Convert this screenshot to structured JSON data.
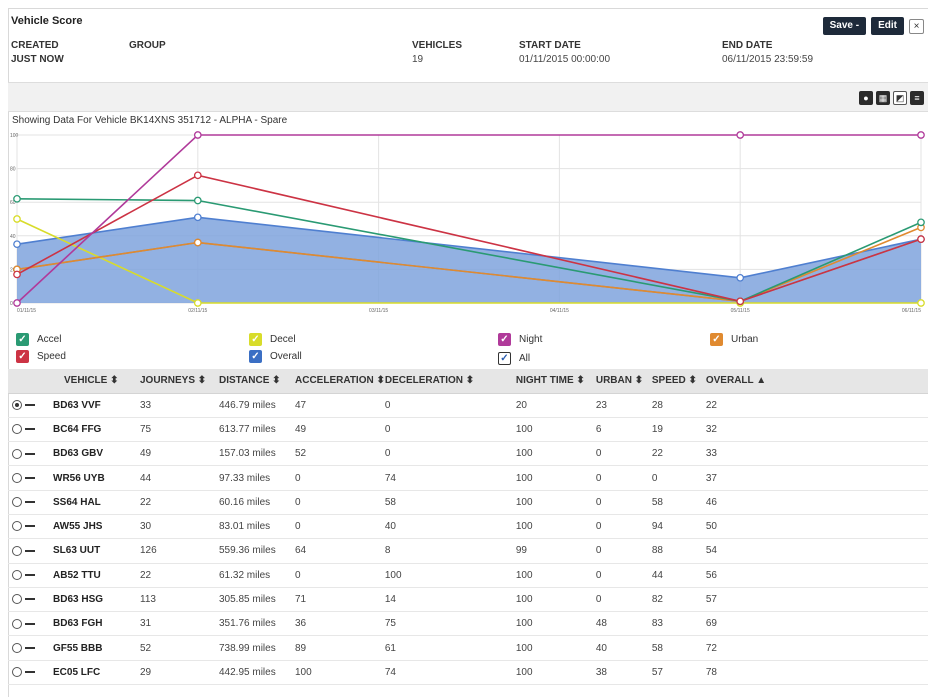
{
  "header": {
    "title": "Vehicle Score",
    "save_label": "Save -",
    "edit_label": "Edit",
    "close_glyph": "×",
    "created_label": "CREATED",
    "created_value": "JUST NOW",
    "group_label": "GROUP",
    "vehicles_label": "VEHICLES",
    "vehicles_value": "19",
    "start_label": "START DATE",
    "start_value": "01/11/2015 00:00:00",
    "end_label": "END DATE",
    "end_value": "06/11/2015 23:59:59"
  },
  "toolbar": {
    "icons": [
      "pie-chart-icon",
      "grid-view-icon",
      "chart-view-icon",
      "list-view-icon"
    ]
  },
  "showing_text": "Showing Data For Vehicle BK14XNS 351712 - ALPHA - Spare",
  "chart_data": {
    "type": "line",
    "x": [
      "01/11/15",
      "02/11/15",
      "03/11/15",
      "04/11/15",
      "05/11/15",
      "06/11/15"
    ],
    "x_ticks_shown": [
      "01/11/15",
      "02/11/15",
      "03/11/15",
      "04/11/15",
      "05/11/15",
      "06/11/15"
    ],
    "ylim": [
      0,
      100
    ],
    "y_ticks": [
      0,
      20,
      40,
      60,
      80,
      100
    ],
    "grid": true,
    "series": [
      {
        "name": "Overall",
        "color": "#4f7fd0",
        "area": true,
        "points": [
          [
            0,
            35
          ],
          [
            1,
            51
          ],
          [
            4,
            15
          ],
          [
            5,
            38
          ]
        ]
      },
      {
        "name": "Accel",
        "color": "#2a9a73",
        "points": [
          [
            0,
            62
          ],
          [
            1,
            61
          ],
          [
            4,
            1
          ],
          [
            5,
            48
          ]
        ]
      },
      {
        "name": "Speed",
        "color": "#cc3344",
        "points": [
          [
            0,
            17
          ],
          [
            1,
            76
          ],
          [
            4,
            1
          ],
          [
            5,
            38
          ]
        ]
      },
      {
        "name": "Night",
        "color": "#b03a9a",
        "points": [
          [
            0,
            0
          ],
          [
            1,
            100
          ],
          [
            4,
            100
          ],
          [
            5,
            100
          ]
        ]
      },
      {
        "name": "Decel",
        "color": "#d8dc2a",
        "points": [
          [
            0,
            50
          ],
          [
            1,
            0
          ],
          [
            4,
            0
          ],
          [
            5,
            0
          ]
        ]
      },
      {
        "name": "Urban",
        "color": "#e08a30",
        "points": [
          [
            0,
            20
          ],
          [
            1,
            36
          ],
          [
            4,
            1
          ],
          [
            5,
            45
          ]
        ]
      },
      {
        "name": "All",
        "color": "#8a8a8a",
        "points": [
          [
            0,
            20
          ],
          [
            1,
            36
          ],
          [
            4,
            1
          ],
          [
            5,
            38
          ]
        ]
      }
    ]
  },
  "legend": [
    {
      "label": "Accel",
      "color": "#2a9a73",
      "checked": true
    },
    {
      "label": "Decel",
      "color": "#d8dc2a",
      "checked": true
    },
    {
      "label": "Night",
      "color": "#b03a9a",
      "checked": true
    },
    {
      "label": "Urban",
      "color": "#e08a30",
      "checked": true
    },
    {
      "label": "Speed",
      "color": "#cc3344",
      "checked": true
    },
    {
      "label": "Overall",
      "color": "#3b6fc4",
      "checked": true
    },
    {
      "label": "All",
      "color": "#ffffff",
      "checked": true
    }
  ],
  "table": {
    "columns": [
      "VEHICLE ⬍",
      "JOURNEYS ⬍",
      "DISTANCE ⬍",
      "ACCELERATION ⬍",
      "DECELERATION ⬍",
      "NIGHT TIME ⬍",
      "URBAN ⬍",
      "SPEED ⬍",
      "OVERALL ▲"
    ],
    "rows": [
      [
        "BD63 VVF",
        "33",
        "446.79 miles",
        "47",
        "0",
        "20",
        "23",
        "28",
        "22"
      ],
      [
        "BC64 FFG",
        "75",
        "613.77 miles",
        "49",
        "0",
        "100",
        "6",
        "19",
        "32"
      ],
      [
        "BD63 GBV",
        "49",
        "157.03 miles",
        "52",
        "0",
        "100",
        "0",
        "22",
        "33"
      ],
      [
        "WR56 UYB",
        "44",
        "97.33 miles",
        "0",
        "74",
        "100",
        "0",
        "0",
        "37"
      ],
      [
        "SS64 HAL",
        "22",
        "60.16 miles",
        "0",
        "58",
        "100",
        "0",
        "58",
        "46"
      ],
      [
        "AW55 JHS",
        "30",
        "83.01 miles",
        "0",
        "40",
        "100",
        "0",
        "94",
        "50"
      ],
      [
        "SL63 UUT",
        "126",
        "559.36 miles",
        "64",
        "8",
        "99",
        "0",
        "88",
        "54"
      ],
      [
        "AB52 TTU",
        "22",
        "61.32 miles",
        "0",
        "100",
        "100",
        "0",
        "44",
        "56"
      ],
      [
        "BD63 HSG",
        "113",
        "305.85 miles",
        "71",
        "14",
        "100",
        "0",
        "82",
        "57"
      ],
      [
        "BD63 FGH",
        "31",
        "351.76 miles",
        "36",
        "75",
        "100",
        "48",
        "83",
        "69"
      ],
      [
        "GF55 BBB",
        "52",
        "738.99 miles",
        "89",
        "61",
        "100",
        "40",
        "58",
        "72"
      ],
      [
        "EC05 LFC",
        "29",
        "442.95 miles",
        "100",
        "74",
        "100",
        "38",
        "57",
        "78"
      ]
    ],
    "selected_row": 0
  }
}
